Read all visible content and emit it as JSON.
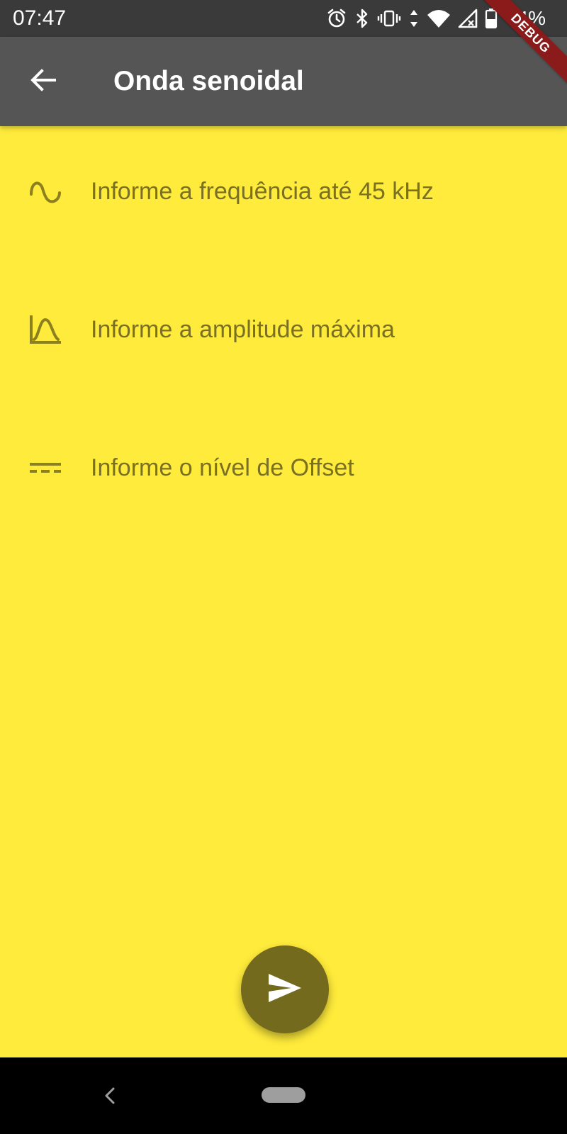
{
  "status_bar": {
    "time": "07:47",
    "battery_percent": "44%",
    "icons": [
      "alarm-icon",
      "bluetooth-icon",
      "vibrate-icon",
      "data-arrows-icon",
      "wifi-icon",
      "signal-no-service-icon",
      "battery-icon"
    ]
  },
  "debug_banner": {
    "label": "DEBUG"
  },
  "app_bar": {
    "title": "Onda senoidal",
    "back_icon": "arrow-back-icon"
  },
  "fields": [
    {
      "icon": "sine-wave-icon",
      "placeholder": "Informe a frequência até 45 kHz"
    },
    {
      "icon": "amplitude-curve-icon",
      "placeholder": "Informe a amplitude máxima"
    },
    {
      "icon": "dc-offset-icon",
      "placeholder": "Informe o nível de Offset"
    }
  ],
  "fab": {
    "icon": "send-icon"
  },
  "nav_bar": {
    "icons": [
      "nav-back-icon",
      "nav-home-pill"
    ]
  },
  "colors": {
    "background": "#ffeb3b",
    "app_bar": "#555555",
    "status_bar": "#3a3a3a",
    "field_text": "#7a7023",
    "fab": "#736a1e",
    "debug_ribbon": "#8b1a1a"
  }
}
